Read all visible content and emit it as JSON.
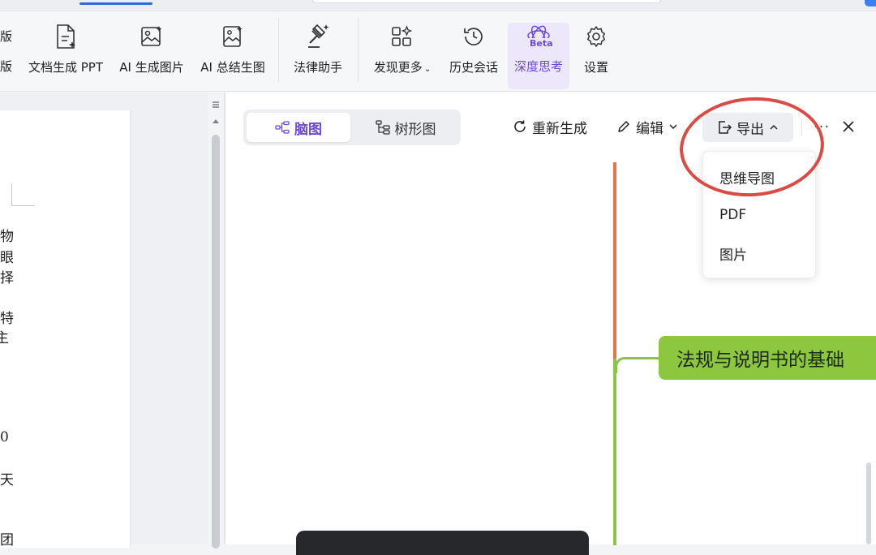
{
  "ribbon": {
    "clipped_labels": [
      "版",
      "版"
    ],
    "items": [
      {
        "label": "文档生成 PPT",
        "icon": "doc-ppt-sparkle-icon"
      },
      {
        "label": "AI 生成图片",
        "icon": "image-sparkle-icon"
      },
      {
        "label": "AI 总结生图",
        "icon": "summary-image-icon"
      },
      {
        "label": "法律助手",
        "icon": "gavel-icon"
      },
      {
        "label": "发现更多",
        "icon": "grid-sparkle-icon"
      },
      {
        "label": "历史会话",
        "icon": "history-clock-icon"
      },
      {
        "label": "深度思考",
        "icon": "atom-beta-icon",
        "badge": "Beta"
      },
      {
        "label": "设置",
        "icon": "gear-icon"
      }
    ]
  },
  "document": {
    "visible_chars": [
      "物",
      "眼",
      "择",
      "特",
      "主",
      "0",
      "天",
      "团"
    ]
  },
  "mindmap_panel": {
    "view_tabs": [
      {
        "label": "脑图",
        "icon": "mindmap-icon",
        "active": true
      },
      {
        "label": "树形图",
        "icon": "tree-icon",
        "active": false
      }
    ],
    "toolbar": {
      "regenerate": "重新生成",
      "edit": "编辑",
      "export": "导出",
      "more": "···"
    },
    "export_menu": [
      "思维导图",
      "PDF",
      "图片"
    ],
    "node_text": "法规与说明书的基础",
    "colors": {
      "accent": "#6b49d6",
      "branch_orange": "#e8744a",
      "branch_green": "#8cc34a",
      "node_green": "#8dc63f",
      "highlight_circle": "#dc4a45"
    }
  }
}
